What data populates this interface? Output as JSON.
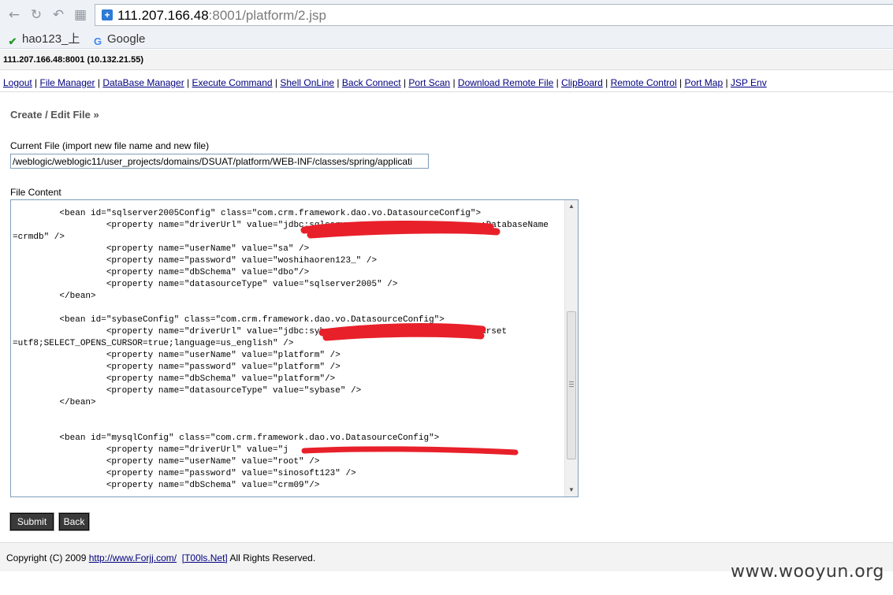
{
  "browser": {
    "url_host": "111.207.166.48",
    "url_rest": ":8001/platform/2.jsp",
    "bookmarks": [
      {
        "label": "hao123_上",
        "icon": "hao123-icon"
      },
      {
        "label": "Google",
        "icon": "google-icon"
      }
    ]
  },
  "server_info": "111.207.166.48:8001 (10.132.21.55)",
  "menu": [
    "Logout",
    "File Manager",
    "DataBase Manager",
    "Execute Command",
    "Shell OnLine",
    "Back Connect",
    "Port Scan",
    "Download Remote File",
    "ClipBoard",
    "Remote Control",
    "Port Map",
    "JSP Env"
  ],
  "section_title": "Create / Edit File »",
  "current_file": {
    "label": "Current File (import new file name and new file)",
    "value": "/weblogic/weblogic11/user_projects/domains/DSUAT/platform/WEB-INF/classes/spring/applicati"
  },
  "file_content": {
    "label": "File Content",
    "text": "         <bean id=\"sqlserver2005Config\" class=\"com.crm.framework.dao.vo.DatasourceConfig\">\n                  <property name=\"driverUrl\" value=\"jdbc:sqlserver                        ;DatabaseName\n=crmdb\" />\n                  <property name=\"userName\" value=\"sa\" />\n                  <property name=\"password\" value=\"woshihaoren123_\" />\n                  <property name=\"dbSchema\" value=\"dbo\"/>\n                  <property name=\"datasourceType\" value=\"sqlserver2005\" />\n         </bean>\n\n         <bean id=\"sybaseConfig\" class=\"com.crm.framework.dao.vo.DatasourceConfig\">\n                  <property name=\"driverUrl\" value=\"jdbc:syb                         db?charset\n=utf8;SELECT_OPENS_CURSOR=true;language=us_english\" />\n                  <property name=\"userName\" value=\"platform\" />\n                  <property name=\"password\" value=\"platform\" />\n                  <property name=\"dbSchema\" value=\"platform\"/>\n                  <property name=\"datasourceType\" value=\"sybase\" />\n         </bean>\n\n\n         <bean id=\"mysqlConfig\" class=\"com.crm.framework.dao.vo.DatasourceConfig\">\n                  <property name=\"driverUrl\" value=\"j                             \n                  <property name=\"userName\" value=\"root\" />\n                  <property name=\"password\" value=\"sinosoft123\" />\n                  <property name=\"dbSchema\" value=\"crm09\"/>"
  },
  "buttons": {
    "submit": "Submit",
    "back": "Back"
  },
  "footer": {
    "prefix": "Copyright (C) 2009 ",
    "link1": "http://www.Forjj.com/",
    "link2": "[T00ls.Net]",
    "suffix": " All Rights Reserved."
  },
  "watermark": "www.wooyun.org",
  "colors": {
    "redaction": "#e8202a",
    "link": "#00007f",
    "button_bg": "#3a3a3a"
  }
}
